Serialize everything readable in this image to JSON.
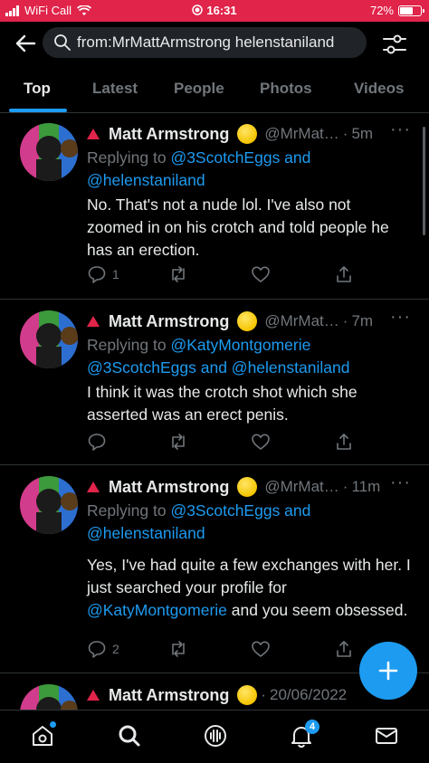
{
  "status_bar": {
    "carrier": "WiFi Call",
    "time": "16:31",
    "battery": "72%",
    "battery_fraction": 0.72
  },
  "search": {
    "query": "from:MrMattArmstrong helenstaniland"
  },
  "tabs": [
    "Top",
    "Latest",
    "People",
    "Photos",
    "Videos"
  ],
  "active_tab": "Top",
  "tweets": [
    {
      "name": "Matt Armstrong",
      "handle": "@MrMat…",
      "time": "5m",
      "replying_prefix": "Replying to",
      "replying_to": "@3ScotchEggs and @helenstaniland",
      "text": "No. That's not a nude lol. I've also not zoomed in on his crotch and told people he has an erection.",
      "replies": "1"
    },
    {
      "name": "Matt Armstrong",
      "handle": "@MrMat…",
      "time": "7m",
      "replying_prefix": "Replying to",
      "replying_to": "@KatyMontgomerie @3ScotchEggs and @helenstaniland",
      "text": "I think it was the crotch shot which she asserted was an erect penis.",
      "replies": ""
    },
    {
      "name": "Matt Armstrong",
      "handle": "@MrMat…",
      "time": "11m",
      "replying_prefix": "Replying to",
      "replying_to": "@3ScotchEggs and @helenstaniland",
      "text_before": "Yes, I've had quite a few exchanges with her. I just searched your profile for",
      "text_mention": "@KatyMontgomerie",
      "text_after": "and you seem obsessed.",
      "replies": "2"
    },
    {
      "name": "Matt Armstrong",
      "handle": "",
      "time": "20/06/2022"
    }
  ],
  "bottom_nav": {
    "notifications_badge": "4"
  },
  "colors": {
    "accent": "#1d9bf0",
    "status_bar": "#e0244a",
    "muted": "#71767b",
    "background": "#000000"
  }
}
